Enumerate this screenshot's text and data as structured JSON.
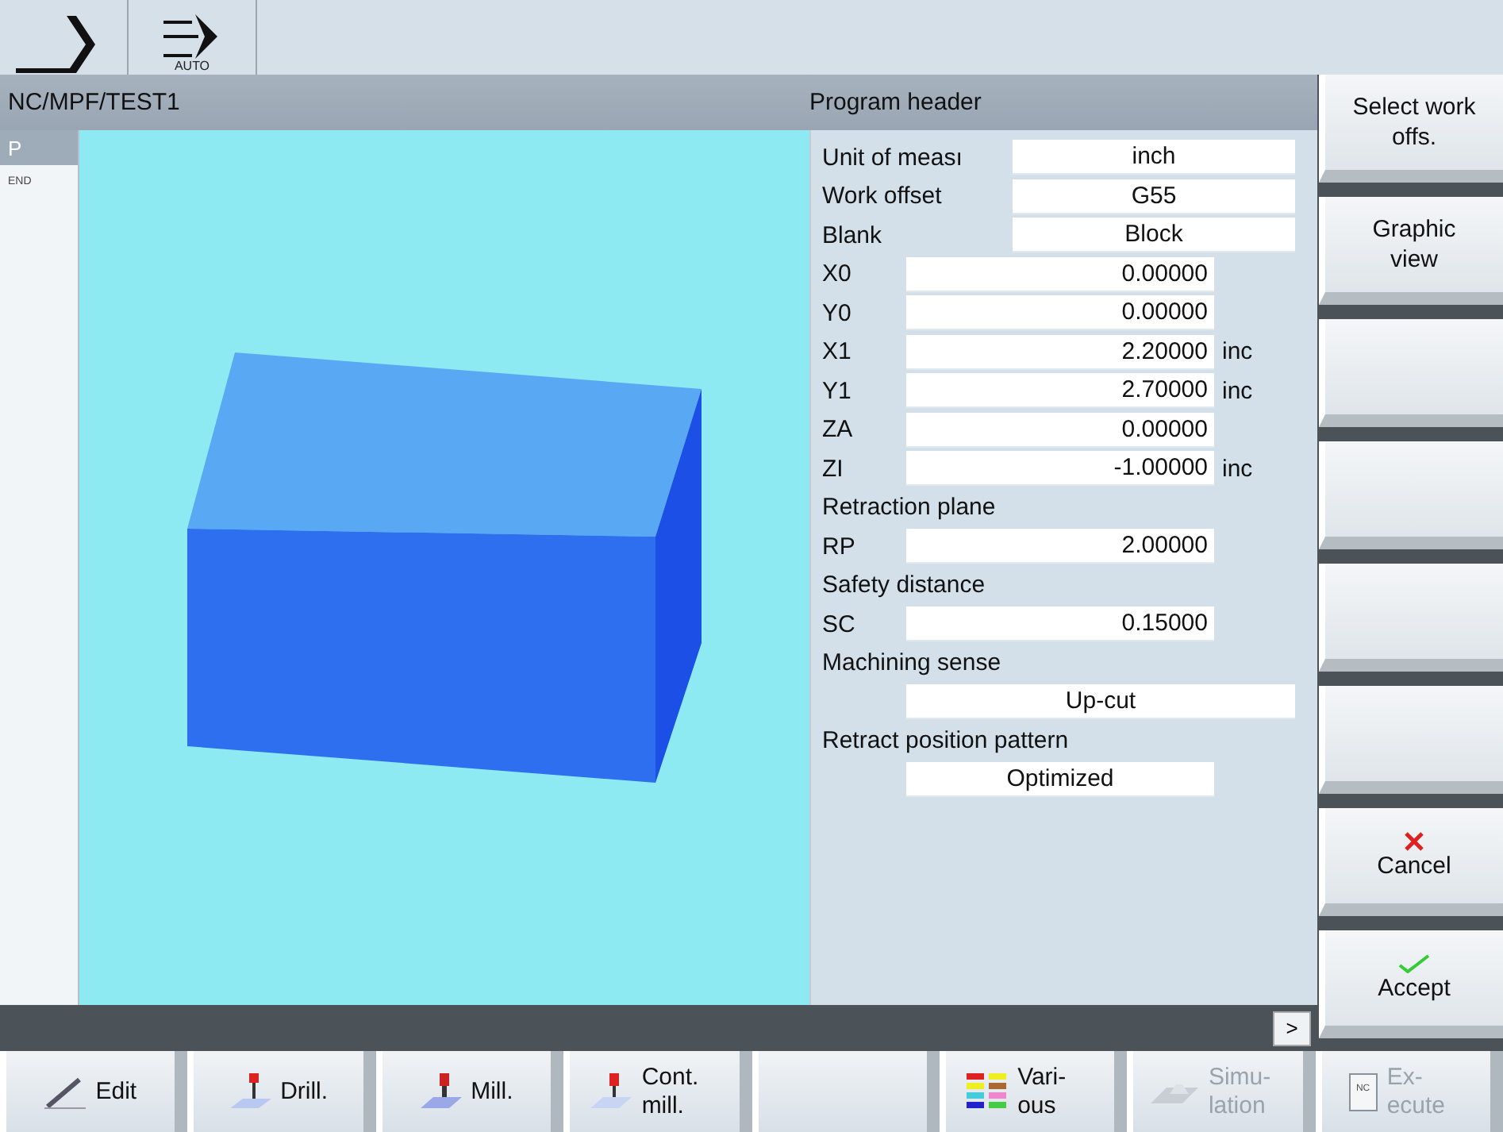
{
  "mode_bar": {
    "modes": [
      {
        "kind": "jog"
      },
      {
        "kind": "auto",
        "label": "AUTO"
      }
    ]
  },
  "header": {
    "path": "NC/MPF/TEST1",
    "title": "Program header"
  },
  "block_strip": [
    {
      "label": "P",
      "selected": true
    },
    {
      "label": "END",
      "selected": false
    }
  ],
  "form": [
    {
      "kind": "select",
      "label": "Unit of meası",
      "value": "inch"
    },
    {
      "kind": "select",
      "label": "Work offset",
      "value": "G55"
    },
    {
      "kind": "select",
      "label": "Blank",
      "value": "Block"
    },
    {
      "kind": "number",
      "label": "X0",
      "value": "0.00000"
    },
    {
      "kind": "number",
      "label": "Y0",
      "value": "0.00000"
    },
    {
      "kind": "number",
      "label": "X1",
      "value": "2.20000",
      "unit": "inc"
    },
    {
      "kind": "number",
      "label": "Y1",
      "value": "2.70000",
      "unit": "inc"
    },
    {
      "kind": "number",
      "label": "ZA",
      "value": "0.00000"
    },
    {
      "kind": "number",
      "label": "ZI",
      "value": "-1.00000",
      "unit": "inc"
    },
    {
      "kind": "heading",
      "label": "Retraction plane"
    },
    {
      "kind": "number",
      "label": "RP",
      "value": "2.00000"
    },
    {
      "kind": "heading",
      "label": "Safety distance"
    },
    {
      "kind": "number",
      "label": "SC",
      "value": "0.15000"
    },
    {
      "kind": "heading",
      "label": "Machining sense"
    },
    {
      "kind": "choice",
      "value": "Up-cut"
    },
    {
      "kind": "heading",
      "label": "Retract position pattern"
    },
    {
      "kind": "toggle",
      "value": "Optimized"
    }
  ],
  "scroll_button": ">",
  "vertical_softkeys": [
    {
      "kind": "text",
      "label": "Select work offs."
    },
    {
      "kind": "text",
      "label": "Graphic view"
    },
    {
      "kind": "blank"
    },
    {
      "kind": "blank"
    },
    {
      "kind": "blank"
    },
    {
      "kind": "blank"
    },
    {
      "kind": "cancel",
      "label": "Cancel"
    },
    {
      "kind": "accept",
      "label": "Accept"
    }
  ],
  "horizontal_softkeys": [
    {
      "kind": "edit",
      "label": "Edit",
      "disabled": false
    },
    {
      "kind": "drill",
      "label": "Drill.",
      "disabled": false
    },
    {
      "kind": "mill",
      "label": "Mill.",
      "disabled": false
    },
    {
      "kind": "contour",
      "label": "Cont. mill.",
      "disabled": false
    },
    {
      "kind": "blank"
    },
    {
      "kind": "various",
      "label": "Vari- ous",
      "disabled": false
    },
    {
      "kind": "simulation",
      "label": "Simu- lation",
      "disabled": true
    },
    {
      "kind": "execute",
      "label": "Ex- ecute",
      "icon_text": "NC",
      "disabled": true
    }
  ]
}
